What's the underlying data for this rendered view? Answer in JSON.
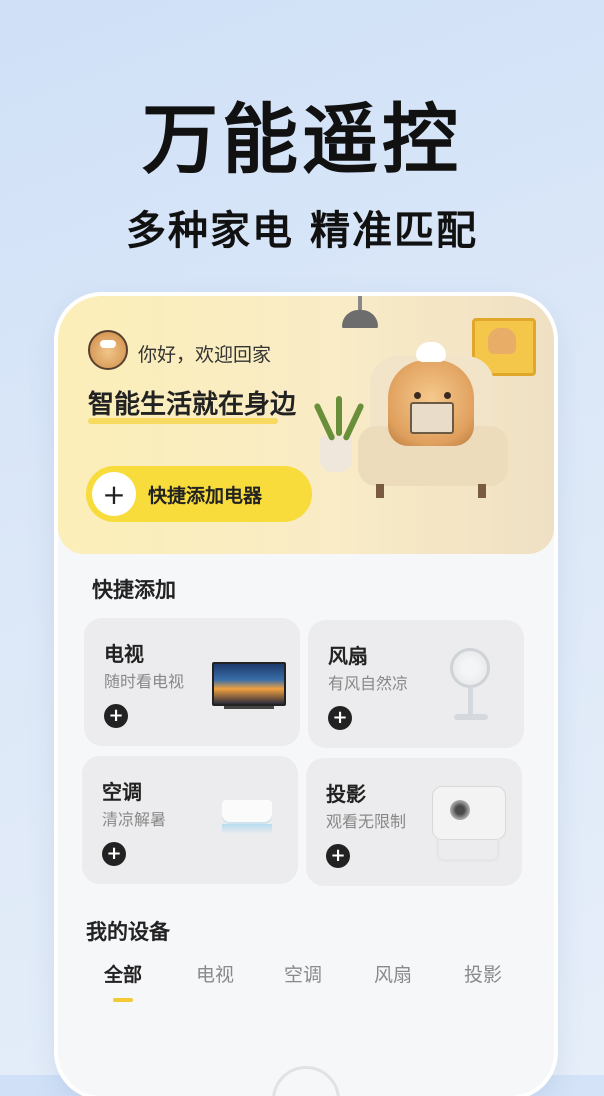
{
  "hero": {
    "title": "万能遥控",
    "subtitle": "多种家电 精准匹配"
  },
  "banner": {
    "greeting": "你好，欢迎回家",
    "slogan": "智能生活就在身边",
    "quick_add_icon": "plus-icon",
    "quick_add_label": "快捷添加电器",
    "accent_color": "#f7dc3c"
  },
  "quick_add": {
    "title": "快捷添加",
    "cards": [
      {
        "name": "电视",
        "desc": "随时看电视",
        "icon": "tv-icon"
      },
      {
        "name": "风扇",
        "desc": "有风自然凉",
        "icon": "fan-icon"
      },
      {
        "name": "空调",
        "desc": "清凉解暑",
        "icon": "air-conditioner-icon"
      },
      {
        "name": "投影",
        "desc": "观看无限制",
        "icon": "projector-icon"
      }
    ],
    "add_symbol": "+"
  },
  "my_devices": {
    "title": "我的设备",
    "tabs": [
      "全部",
      "电视",
      "空调",
      "风扇",
      "投影"
    ],
    "active_tab": "全部"
  }
}
